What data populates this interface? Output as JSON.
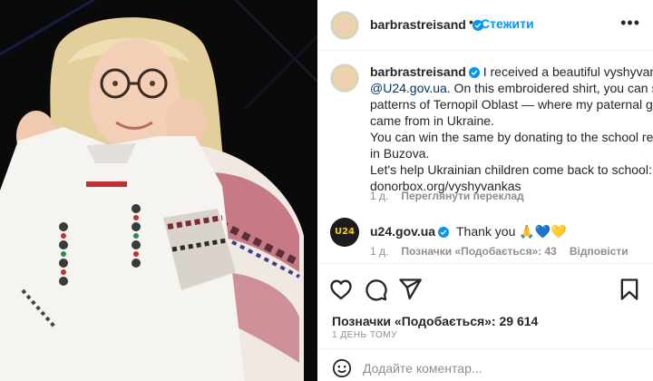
{
  "post": {
    "username": "barbrastreisand",
    "follow_label": "Стежити",
    "separator": "•",
    "more": "•••"
  },
  "caption": {
    "username": "barbrastreisand",
    "line1_text": " I received a beautiful vyshyvanka fro",
    "line2_link": "@U24.gov.ua",
    "line2_text": ". On this embroidered shirt, you can see t",
    "line3": "patterns of Ternopil Oblast — where my paternal grand",
    "line4": "came from in Ukraine.",
    "line5": "You can win the same by donating to the school recons",
    "line6": "in Buzova.",
    "line7": "Let's help Ukrainian children come back to school:",
    "line8": "donorbox.org/vyshyvankas",
    "age": "1 д.",
    "translate": "Переглянути переклад"
  },
  "reply": {
    "avatar_text": "U24",
    "username": "u24.gov.ua",
    "text": "Thank you 🙏💙💛",
    "age": "1 д.",
    "likes": "Позначки «Подобається»: 43",
    "reply_label": "Відповісти"
  },
  "stats": {
    "likes": "Позначки «Подобається»: 29 614",
    "time": "1 ДЕНЬ ТОМУ"
  },
  "composer": {
    "placeholder": "Додайте коментар..."
  },
  "icons": [
    "verified-icon",
    "heart-icon",
    "comment-icon",
    "share-icon",
    "bookmark-icon",
    "emoji-icon",
    "more-icon"
  ],
  "colors": {
    "link": "#00376b",
    "accent": "#0095f6",
    "verified": "#0095f6",
    "muted": "#8e8e8e"
  }
}
